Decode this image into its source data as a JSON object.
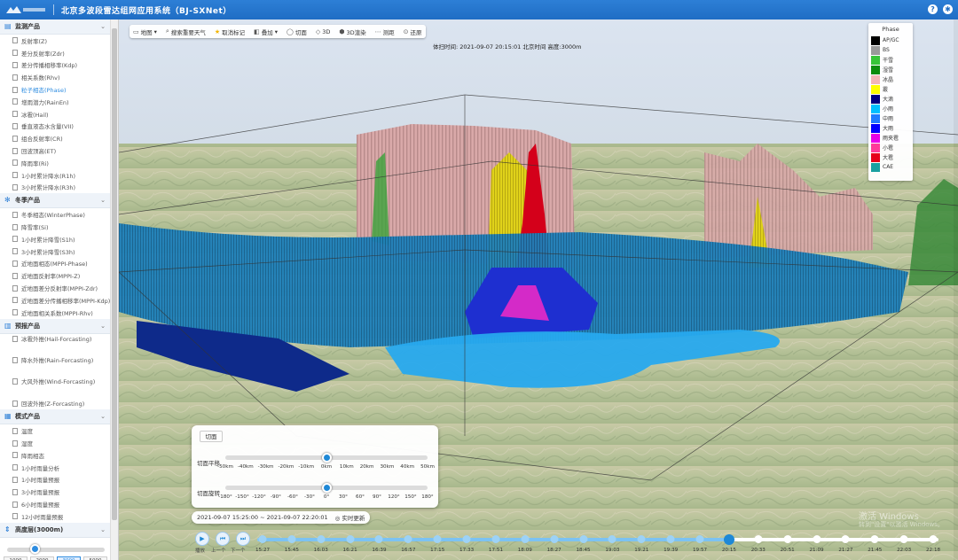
{
  "header": {
    "title": "北京多波段雷达组网应用系统（BJ-SXNet）",
    "help_icon": "help-icon",
    "settings_icon": "gear-icon"
  },
  "sidebar": {
    "sections": [
      {
        "title": "监测产品",
        "icon": "monitor-icon",
        "items": [
          "反射率(Z)",
          "差分反射率(Zdr)",
          "差分传播相移率(Kdp)",
          "相关系数(Rhv)",
          "粒子相态(Phase)",
          "增雨潜力(RainEn)",
          "冰雹(Hail)",
          "垂直液态水含量(VII)",
          "组合反射率(CR)",
          "回波顶高(ET)",
          "降雨率(Ri)",
          "1小时累计降水(R1h)",
          "3小时累计降水(R3h)"
        ],
        "active_index": 4
      },
      {
        "title": "冬季产品",
        "icon": "snowflake-icon",
        "items": [
          "冬季相态(WinterPhase)",
          "降雪率(Si)",
          "1小时累计降雪(S1h)",
          "3小时累计降雪(S3h)",
          "近地面相态(MPPI-Phase)",
          "近地面反射率(MPPI-Z)",
          "近地面差分反射率(MPPI-Zdr)",
          "近地面差分传播相移率(MPPI-Kdp)",
          "近地面相关系数(MPPI-Rhv)"
        ]
      },
      {
        "title": "预报产品",
        "icon": "forecast-icon",
        "items": [
          "冰雹外推(Hail-Forcasting)",
          "降水外推(Rain-Forcasting)",
          "大风外推(Wind-Forcasting)",
          "回波外推(Z-Forcasting)"
        ]
      },
      {
        "title": "模式产品",
        "icon": "model-icon",
        "items": [
          "温度",
          "湿度",
          "降雨相态",
          "1小时雨量分析",
          "1小时雨量预报",
          "3小时雨量预报",
          "6小时雨量预报",
          "12小时雨量预报"
        ]
      },
      {
        "title": "高度层(3000m)",
        "icon": "altitude-icon",
        "items": []
      }
    ],
    "height_buttons": [
      "1000",
      "2000",
      "3000",
      "5000"
    ],
    "height_selected": "3000",
    "height_slider_fraction": 0.28
  },
  "toolbar": {
    "items": [
      {
        "label": "地图",
        "icon": "map-icon",
        "dropdown": true
      },
      {
        "label": "搜索重要天气",
        "icon": "search-icon"
      },
      {
        "label": "取消标记",
        "icon": "star-icon"
      },
      {
        "label": "叠加",
        "icon": "layers-icon",
        "dropdown": true
      },
      {
        "label": "切面",
        "icon": "cut-icon"
      },
      {
        "label": "3D",
        "icon": "cube-icon"
      },
      {
        "label": "3D渲染",
        "icon": "render-icon"
      },
      {
        "label": "测距",
        "icon": "ruler-icon"
      },
      {
        "label": "还原",
        "icon": "reset-icon"
      }
    ]
  },
  "obs_time": "体扫时间: 2021-09-07 20:15:01 北京时间    高度:3000m",
  "legend": {
    "title": "Phase",
    "entries": [
      {
        "label": "AP/GC",
        "color": "#000000"
      },
      {
        "label": "BS",
        "color": "#9a9a9a"
      },
      {
        "label": "干雪",
        "color": "#37c437"
      },
      {
        "label": "湿雪",
        "color": "#0c8c0c"
      },
      {
        "label": "冰晶",
        "color": "#f3b6b6"
      },
      {
        "label": "霰",
        "color": "#ffff00"
      },
      {
        "label": "大滴",
        "color": "#000080"
      },
      {
        "label": "小雨",
        "color": "#00bfff"
      },
      {
        "label": "中雨",
        "color": "#1e7cff"
      },
      {
        "label": "大雨",
        "color": "#0000ff"
      },
      {
        "label": "雨夹雹",
        "color": "#e600e6"
      },
      {
        "label": "小雹",
        "color": "#ff3b9a"
      },
      {
        "label": "大雹",
        "color": "#e6001a"
      },
      {
        "label": "CAE",
        "color": "#1aa0a0"
      }
    ]
  },
  "cut_panel": {
    "tab_label": "切面",
    "translate_label": "切面平移",
    "translate_ticks": [
      "-50km",
      "-40km",
      "-30km",
      "-20km",
      "-10km",
      "0km",
      "10km",
      "20km",
      "30km",
      "40km",
      "50km"
    ],
    "translate_value": "0km",
    "rotate_label": "切面旋转",
    "rotate_ticks": [
      "-180°",
      "-150°",
      "-120°",
      "-90°",
      "-60°",
      "-30°",
      "0°",
      "30°",
      "60°",
      "90°",
      "120°",
      "150°",
      "180°"
    ],
    "rotate_value": "0°"
  },
  "time_range": {
    "text": "2021-09-07 15:25:00 ~ 2021-09-07 22:20:01",
    "realtime_label": "实时更新"
  },
  "timeline": {
    "play_label": "播放",
    "prev_label": "上一个",
    "next_label": "下一个",
    "times": [
      "15:27",
      "15:45",
      "16:03",
      "16:21",
      "16:39",
      "16:57",
      "17:15",
      "17:33",
      "17:51",
      "18:09",
      "18:27",
      "18:45",
      "19:03",
      "19:21",
      "19:39",
      "19:57",
      "20:15",
      "20:33",
      "20:51",
      "21:09",
      "21:27",
      "21:45",
      "22:03",
      "22:18"
    ],
    "current": "20:15"
  },
  "watermark": {
    "line1": "激活 Windows",
    "line2": "转到\"设置\"以激活 Windows。"
  }
}
